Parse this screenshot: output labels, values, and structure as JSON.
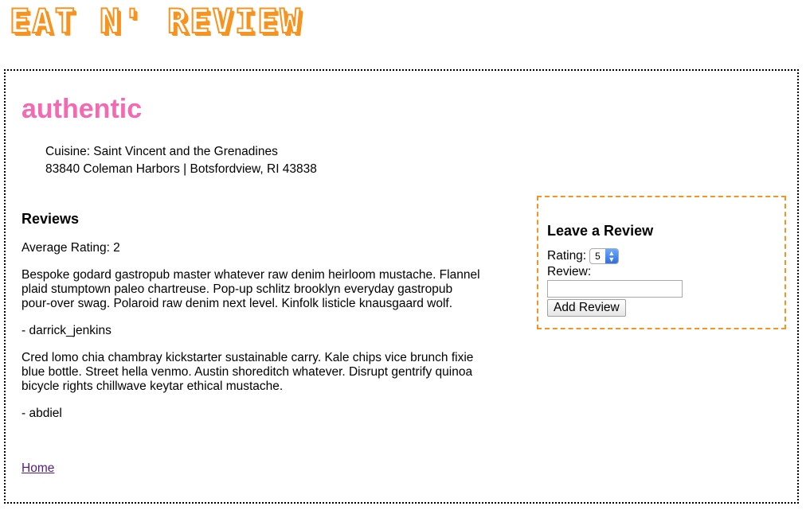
{
  "header": {
    "logo_text": "EAT N' REVIEW"
  },
  "restaurant": {
    "name": "authentic",
    "cuisine": "Cuisine: Saint Vincent and the Grenadines",
    "address": "83840 Coleman Harbors | Botsfordview, RI 43838"
  },
  "reviews": {
    "heading": "Reviews",
    "average": "Average Rating: 2",
    "items": [
      {
        "text": "Bespoke godard gastropub master whatever raw denim heirloom mustache. Flannel plaid stumptown paleo chartreuse. Pop-up schlitz brooklyn everyday gastropub pour-over swag. Polaroid raw denim next level. Kinfolk listicle knausgaard wolf.",
        "author": "- darrick_jenkins"
      },
      {
        "text": "Cred lomo chia chambray kickstarter sustainable carry. Kale chips vice brunch fixie blue bottle. Street hella venmo. Austin shoreditch whatever. Disrupt gentrify quinoa bicycle rights chillwave keytar ethical mustache.",
        "author": "- abdiel"
      }
    ]
  },
  "form": {
    "heading": "Leave a Review",
    "rating_label": "Rating:",
    "rating_value": "5",
    "review_label": "Review:",
    "review_value": "",
    "submit_label": "Add Review"
  },
  "nav": {
    "home_label": "Home"
  },
  "colors": {
    "accent_orange": "#f7931e",
    "title_pink": "#f36ab2",
    "link_purple": "#551a8b"
  }
}
